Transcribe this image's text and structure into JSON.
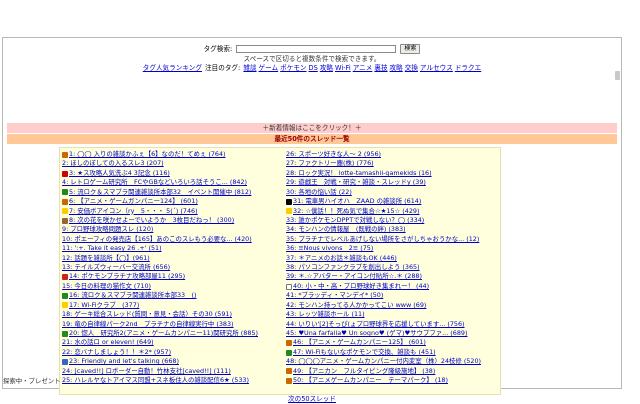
{
  "search": {
    "label": "タグ検索:",
    "input_value": "",
    "button_label": "検索",
    "hint": "スペースで区切ると複数条件で検索できます。"
  },
  "tag_nav": {
    "ranking_link": "タグ人気ランキング",
    "featured_label": "注目のタグ:",
    "tags": [
      "雑談",
      "ゲーム",
      "ポケモン",
      "DS",
      "攻略",
      "Wi-Fi",
      "アニメ",
      "裏技",
      "攻略",
      "交換",
      "アルセウス",
      "ドラクエ"
    ]
  },
  "news_bar": "＋新着情報はここをクリック！＋",
  "threads_header": "最近50件のスレッド一覧",
  "threads_left": [
    {
      "text": "1: ◯◯ 入りの雑談かふぇ【6】なのだ！てめぇ (764)",
      "icon": "#cc6600"
    },
    {
      "text": "2: ほしのぼしての入るスレ3 (207)",
      "icon": ""
    },
    {
      "text": "3: ★ス攻略人気洗ぶ4 3記念 (116)",
      "icon": "#d00000"
    },
    {
      "text": "4: レトロゲーム研究所　FCやGBなどいろいろ話そうこ... (842)",
      "icon": ""
    },
    {
      "text": "5: 流ロク＆スマブラ関連雑談所本部32　イベント開催中 (812)",
      "icon": "#228822"
    },
    {
      "text": "6: 【アニメ・ゲームガンパニー124】 (601)",
      "icon": "#cc6600"
    },
    {
      "text": "7: 安価ボアイコン（ry　5・・・ 5(´) (746)",
      "icon": "#ffcc00"
    },
    {
      "text": "8: 次の花を咲かせよーでいようか　3枚目だねっ！ (300)",
      "icon": "#996633"
    },
    {
      "text": "9: プロ野球攻略問題スレ (120)",
      "icon": ""
    },
    {
      "text": "10: ポエーフィの発売店【165】あのこのスレもう必要な... (420)",
      "icon": ""
    },
    {
      "text": "11: ':+. Take it easy 26 .+' (51)",
      "icon": ""
    },
    {
      "text": "12: 話題を雑談所【◯】(961)",
      "icon": ""
    },
    {
      "text": "13: テイルズウィーバー交流所 (656)",
      "icon": ""
    },
    {
      "text": "14: ポケモンプラチナ攻略部屋11 (295)",
      "icon": "#cc2222"
    },
    {
      "text": "15: 今日の料理の猫作文 (710)",
      "icon": ""
    },
    {
      "text": "16: 流ロク＆スマブラ関連雑談所本部33　() ",
      "icon": "#228822"
    },
    {
      "text": "17: Wi-Fiクラブ　(377)",
      "icon": "#ffcc00"
    },
    {
      "text": "18: ゲーキ総合スレッド(質問・意見・会話）その30 (591)",
      "icon": ""
    },
    {
      "text": "19: 竜の自律線パーク2nd　プラチナの自律線実行中 (383)",
      "icon": ""
    },
    {
      "text": "20: 惚人　研究所2(アニメ・ゲームカンパニー11)関研究所 (885)",
      "icon": "#228822"
    },
    {
      "text": "21: 水の話ロ or eleven! (649)",
      "icon": ""
    },
    {
      "text": "22: 恋バナしましょう！！＊2* (957)",
      "icon": ""
    },
    {
      "text": "23: Friendly and let's talking (668)",
      "icon": "#3366cc"
    },
    {
      "text": "24: [caved!!] ロボーダー自動！竹林支社[caved!!] (111)",
      "icon": ""
    },
    {
      "text": "25: ハレルヤなトアイマス同盟+スネ板住人の雑談配信6★ (533)",
      "icon": ""
    }
  ],
  "threads_right": [
    {
      "text": "26: スポーツ好きな人～ 2 (956)",
      "icon": ""
    },
    {
      "text": "27: ファクトリー塵(株) (776)",
      "icon": ""
    },
    {
      "text": "28: ロック実況！ lotte-tamashii-gamekids (16)",
      "icon": ""
    },
    {
      "text": "29: 遊戯王　対戦・研究・雑談・スレッドy (39)",
      "icon": ""
    },
    {
      "text": "30: 各地の悩い話 (22)",
      "icon": ""
    },
    {
      "text": "31: 電車男ハイオハ　ZAAD の雑談所 (614)",
      "icon": "#000000"
    },
    {
      "text": "32: ☆僕話！！死ぬ気で集合☆★15☆ (429)",
      "icon": "#ffcc00"
    },
    {
      "text": "33: 誰かポケモンDPPTで対戦しない？◯ (334)",
      "icon": ""
    },
    {
      "text": "34: モンハンの情報屋　(既戦の絆) (383)",
      "icon": ""
    },
    {
      "text": "35: プラチナでレベルあげしない場所をさがしちゃおうかな... (12)",
      "icon": ""
    },
    {
      "text": "36: ≡Nous vivons　2≡ (75)",
      "icon": ""
    },
    {
      "text": "37: ＊アニメのお話＊雑談もOK (446)",
      "icon": ""
    },
    {
      "text": "38: パソコンファンクラブを創出しよう (365)",
      "icon": ""
    },
    {
      "text": "39: ＊.☆アバター・アイコン付貼所☆.＊ (288)",
      "icon": ""
    },
    {
      "text": "40: 小・中・高・プロ野球好き集まれー！ (44)",
      "icon": "#ffffff"
    },
    {
      "text": "41: *ブラッディ・マンデイ* (50)",
      "icon": ""
    },
    {
      "text": "42: モンハン持ってる人かかってこい www (69)",
      "icon": ""
    },
    {
      "text": "43: レッツ雑談ホール (11)",
      "icon": ""
    },
    {
      "text": "44: いりい'[2]そっぴ(ょプロ野球界を応援しています... (756)",
      "icon": ""
    },
    {
      "text": "45: ♥Una farfalla♥ Un sogno♥ (ゲマ)♥サウプファ... (689)",
      "icon": ""
    },
    {
      "text": "46: 【アニメ・ゲームカンパニー125】 (601)",
      "icon": "#cc6600"
    },
    {
      "text": "47: Wi-Fiもないなポケモンで交換、雑談も (451)",
      "icon": "#228822"
    },
    {
      "text": "48: ◯◯◯アニメ・ゲームカンパニー付内変室（株）24枝修 (520)",
      "icon": ""
    },
    {
      "text": "49: 【アニカン　フルタイピング隆級施地】 (38)",
      "icon": "#cc6600"
    },
    {
      "text": "50: 【アニメゲームカンパニー　テーマパーク】 (18)",
      "icon": "#cc6600"
    }
  ],
  "next_link": "次の50スレッド",
  "footer": "探索中・プレゼント"
}
